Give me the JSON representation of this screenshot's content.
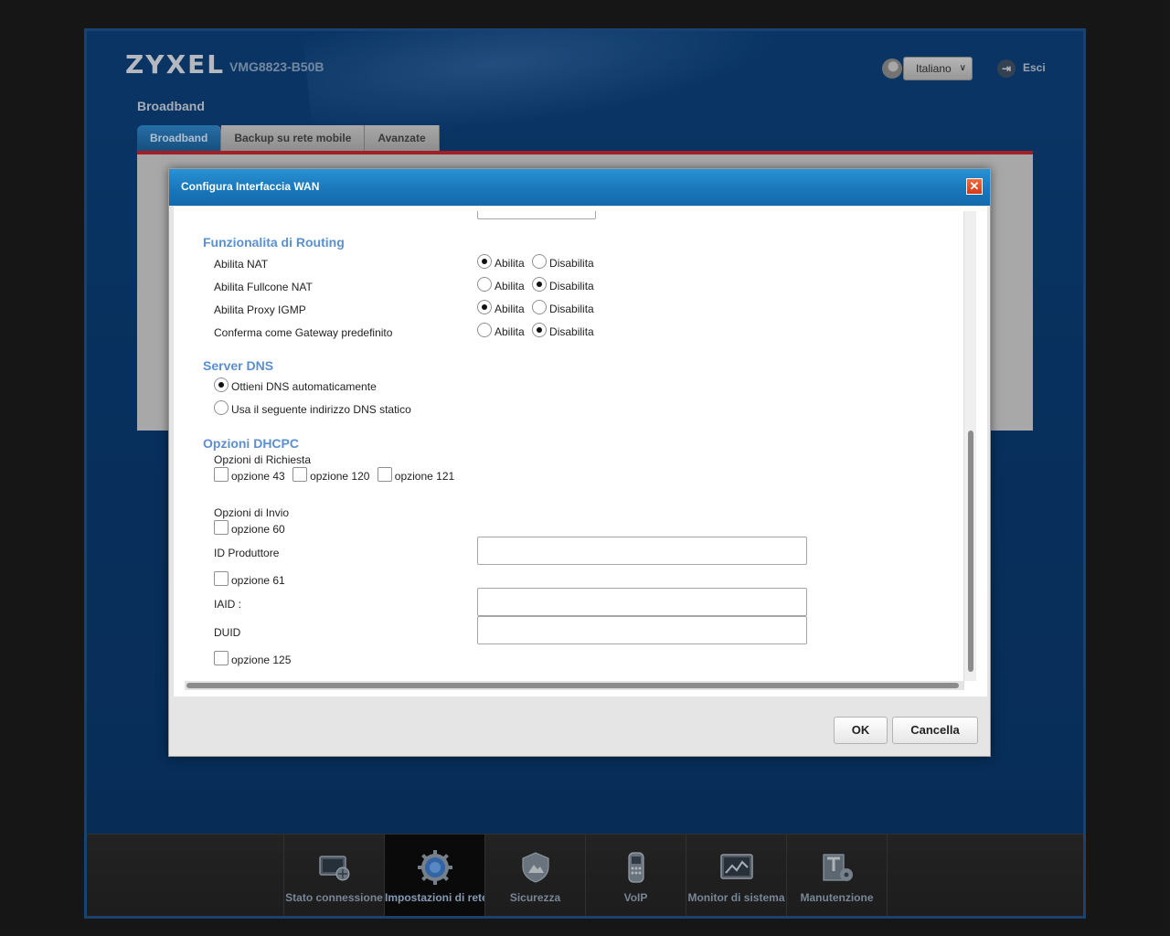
{
  "header": {
    "logo": "ZYXEL",
    "model": "VMG8823-B50B",
    "language": "Italiano",
    "logout": "Esci"
  },
  "page": {
    "title": "Broadband",
    "tabs": [
      {
        "label": "Broadband",
        "active": true
      },
      {
        "label": "Backup su rete mobile"
      },
      {
        "label": "Avanzate"
      }
    ]
  },
  "dialog": {
    "title": "Configura Interfaccia WAN",
    "routing": {
      "title": "Funzionalita di Routing",
      "enable": "Abilita",
      "disable": "Disabilita",
      "rows": [
        {
          "label": "Abilita NAT",
          "value": "Abilita"
        },
        {
          "label": "Abilita Fullcone NAT",
          "value": "Disabilita"
        },
        {
          "label": "Abilita Proxy IGMP",
          "value": "Abilita"
        },
        {
          "label": "Conferma come Gateway predefinito",
          "value": "Disabilita"
        }
      ]
    },
    "dns": {
      "title": "Server DNS",
      "auto": "Ottieni DNS automaticamente",
      "static": "Usa il seguente indirizzo DNS statico",
      "selected": "auto"
    },
    "dhcpc": {
      "title": "Opzioni DHCPC",
      "request_title": "Opzioni di Richiesta",
      "request_options": [
        "opzione 43",
        "opzione 120",
        "opzione 121"
      ],
      "send_title": "Opzioni di Invio",
      "opt60": "opzione 60",
      "vendor_id_label": "ID Produttore",
      "vendor_id_value": "",
      "opt61": "opzione 61",
      "iaid_label": "IAID :",
      "iaid_value": "",
      "duid_label": "DUID",
      "duid_value": "",
      "opt125": "opzione 125"
    },
    "ok": "OK",
    "cancel": "Cancella"
  },
  "nav": {
    "items": [
      {
        "label": "Stato connessione",
        "icon": "status-connection-icon"
      },
      {
        "label": "Impostazioni di rete",
        "icon": "network-settings-icon",
        "active": true
      },
      {
        "label": "Sicurezza",
        "icon": "security-shield-icon"
      },
      {
        "label": "VoIP",
        "icon": "voip-phone-icon"
      },
      {
        "label": "Monitor di sistema",
        "icon": "system-monitor-icon"
      },
      {
        "label": "Manutenzione",
        "icon": "maintenance-icon"
      }
    ]
  }
}
